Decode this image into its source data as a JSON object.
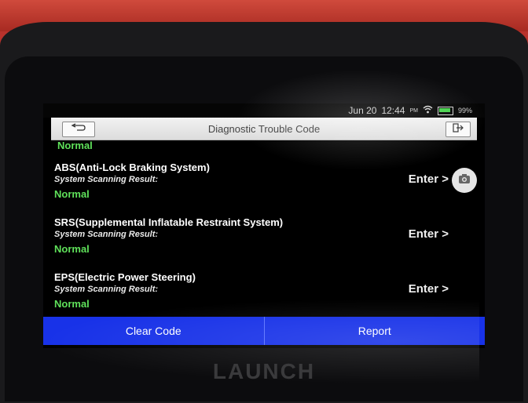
{
  "device": {
    "brand": "LAUNCH"
  },
  "status_bar": {
    "date": "Jun 20",
    "time": "12:44",
    "ampm": "PM",
    "battery": "99%"
  },
  "titlebar": {
    "title": "Diagnostic Trouble Code"
  },
  "top_status": "Normal",
  "systems": [
    {
      "name": "ABS(Anti-Lock Braking System)",
      "result_label": "System Scanning Result:",
      "status": "Normal",
      "enter_label": "Enter >"
    },
    {
      "name": "SRS(Supplemental Inflatable Restraint System)",
      "result_label": "System Scanning Result:",
      "status": "Normal",
      "enter_label": "Enter >"
    },
    {
      "name": "EPS(Electric Power Steering)",
      "result_label": "System Scanning Result:",
      "status": "Normal",
      "enter_label": "Enter >"
    }
  ],
  "buttons": {
    "clear": "Clear Code",
    "report": "Report"
  },
  "colors": {
    "accent": "#1832e8",
    "normal_status": "#5fe05a"
  }
}
